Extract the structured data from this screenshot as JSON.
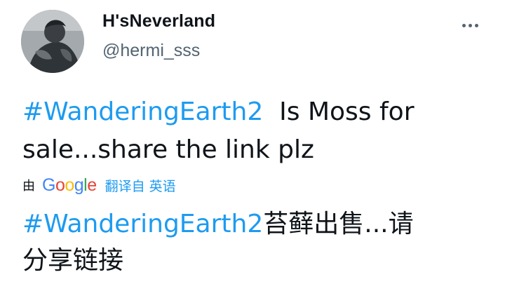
{
  "user": {
    "display_name": "H'sNeverland",
    "handle": "@hermi_sss"
  },
  "tweet": {
    "original": {
      "hashtag": "#WanderingEarth2",
      "line1_text": "  Is Moss for",
      "line2_text": "sale...share the link plz"
    },
    "translation_bar": {
      "by_label": "由",
      "google_letters": [
        "G",
        "o",
        "o",
        "g",
        "l",
        "e"
      ],
      "translate_label": "翻译自 英语"
    },
    "translated": {
      "hashtag": "#WanderingEarth2",
      "line1_text": "苔藓出售...请",
      "line2_text": "分享链接"
    }
  },
  "icons": {
    "avatar": "profile-photo",
    "more": "more-dots-icon"
  },
  "colors": {
    "hashtag": "#1d9bf0",
    "text": "#0f1419",
    "secondary": "#536471",
    "google_blue": "#4285f4",
    "google_red": "#ea4335",
    "google_yellow": "#fbbc05",
    "google_green": "#34a853"
  }
}
